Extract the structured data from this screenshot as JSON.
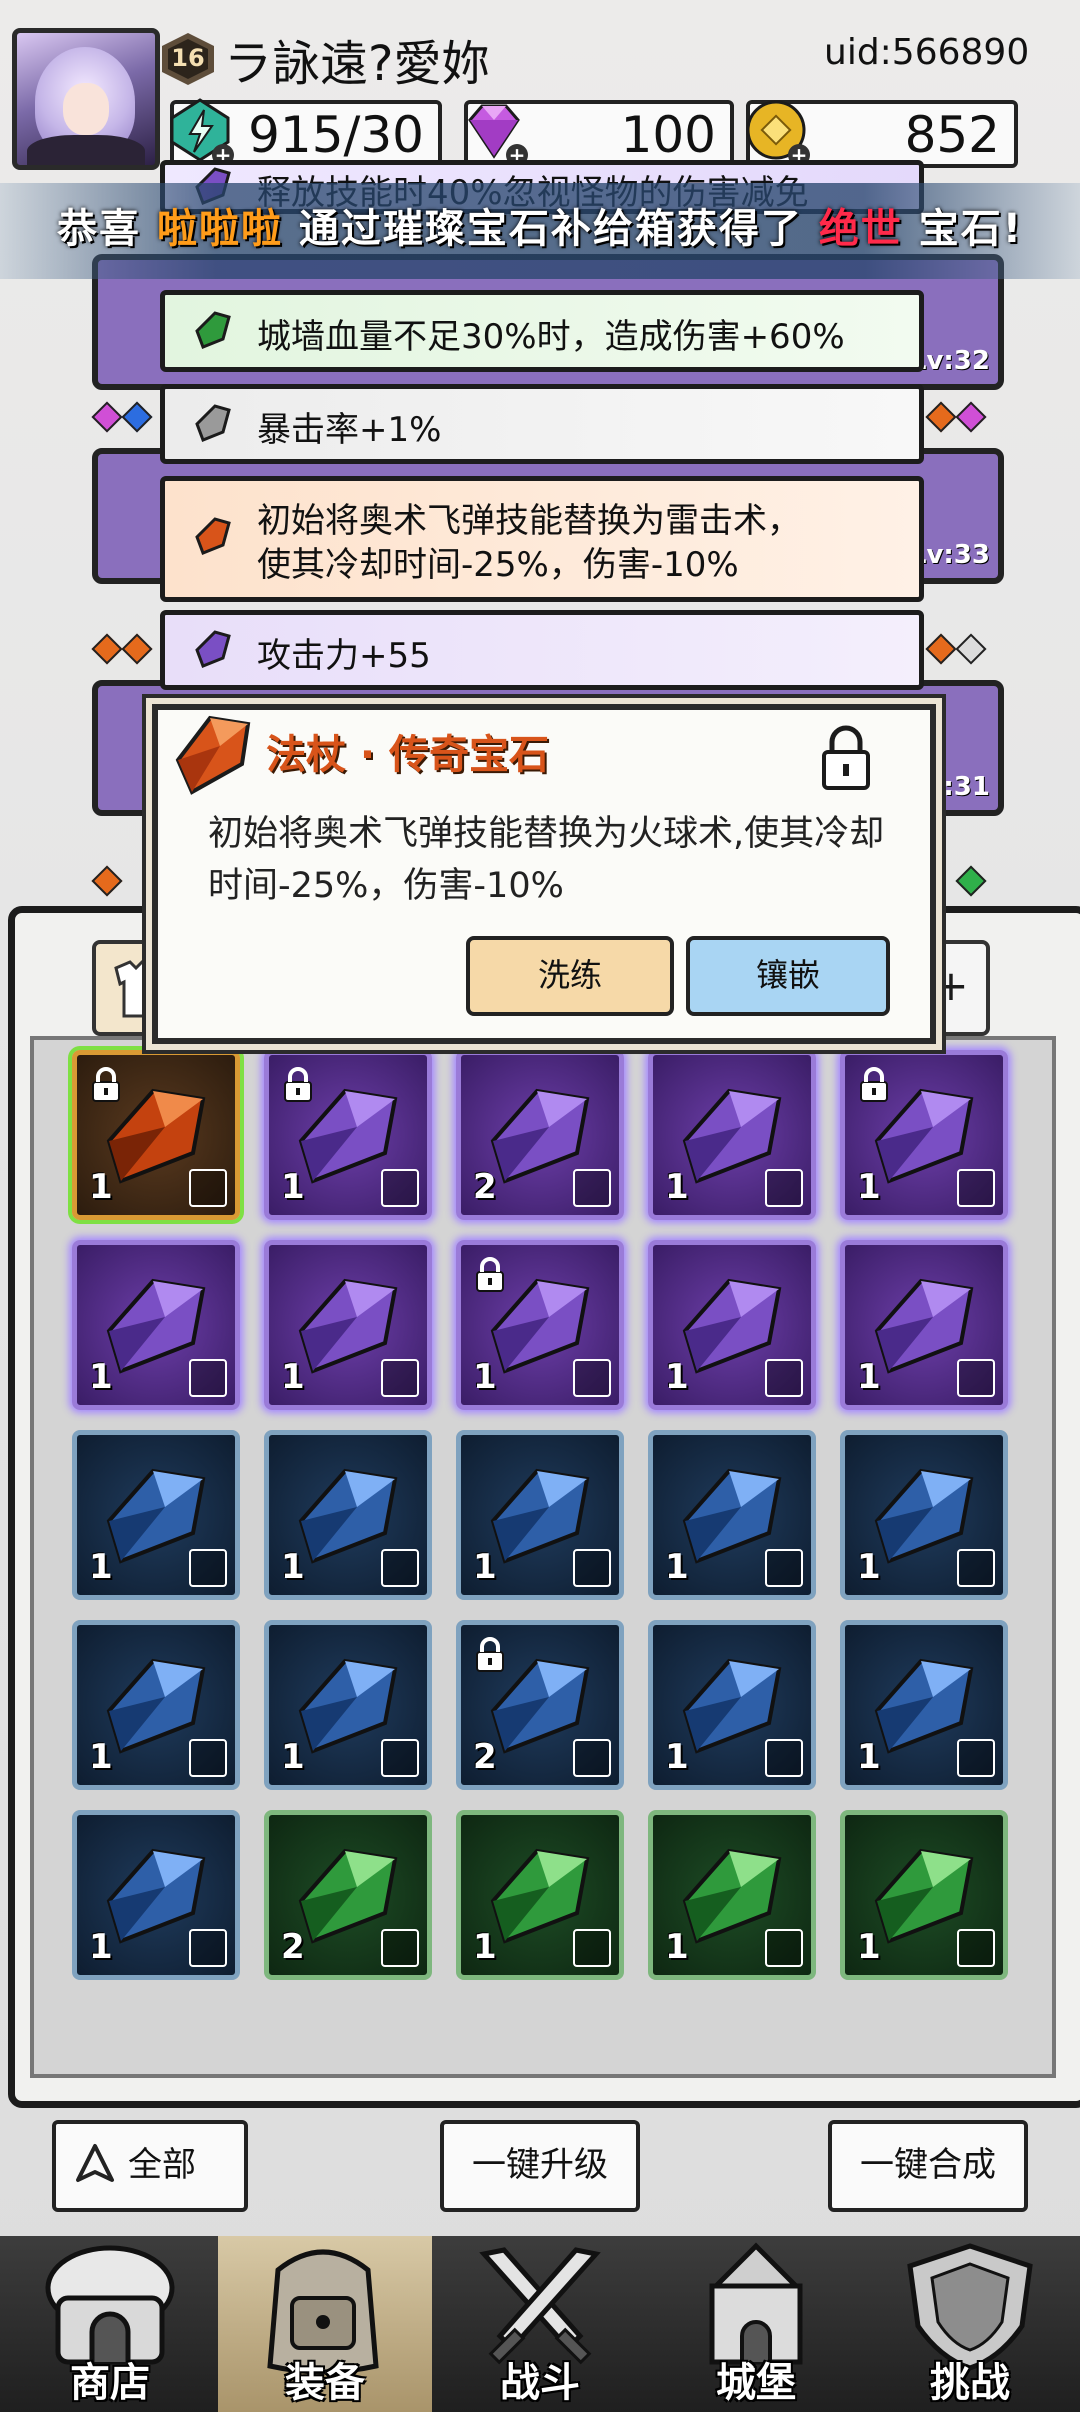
{
  "player": {
    "name": "ラ詠遠?愛妳",
    "level": "16",
    "uid": "uid:566890"
  },
  "resources": {
    "energy": "915/30",
    "gems": "100",
    "gold": "852"
  },
  "banner": {
    "prefix": "恭喜 ",
    "player": "啦啦啦",
    "middle": " 通过璀璨宝石补给箱获得了 ",
    "rarity": "绝世",
    "suffix": " 宝石!"
  },
  "equipment_levels": [
    "Lv:32",
    "Lv:33",
    "Lv:31"
  ],
  "gem_stats": [
    {
      "text": "释放技能时40%忽视怪物的伤害减免",
      "color": "purple"
    },
    {
      "text": "城墙血量不足30%时，造成伤害+60%",
      "color": "green"
    },
    {
      "text": "暴击率+1%",
      "color": "gray"
    },
    {
      "text": "初始将奥术飞弹技能替换为雷击术，",
      "text2": "使其冷却时间-25%，伤害-10%",
      "color": "orange"
    },
    {
      "text": "攻击力+55",
      "color": "purple"
    }
  ],
  "tooltip": {
    "title": "法杖 · 传奇宝石",
    "description": "初始将奥术飞弹技能替换为火球术,使其冷却时间-25%，伤害-10%",
    "refine_label": "洗练",
    "inlay_label": "镶嵌"
  },
  "inventory": [
    {
      "tier": "orange",
      "count": "1",
      "slot": "staff",
      "locked": true
    },
    {
      "tier": "purple",
      "count": "1",
      "slot": "ring",
      "locked": true
    },
    {
      "tier": "purple",
      "count": "2",
      "slot": "ring",
      "locked": false
    },
    {
      "tier": "purple",
      "count": "1",
      "slot": "armor",
      "locked": false
    },
    {
      "tier": "purple",
      "count": "1",
      "slot": "armor",
      "locked": true
    },
    {
      "tier": "purple",
      "count": "1",
      "slot": "boots",
      "locked": false
    },
    {
      "tier": "purple",
      "count": "1",
      "slot": "boots",
      "locked": false
    },
    {
      "tier": "purple",
      "count": "1",
      "slot": "staff",
      "locked": true
    },
    {
      "tier": "purple",
      "count": "1",
      "slot": "necklace",
      "locked": false
    },
    {
      "tier": "purple",
      "count": "1",
      "slot": "necklace",
      "locked": false
    },
    {
      "tier": "blue",
      "count": "1",
      "slot": "ring",
      "locked": false
    },
    {
      "tier": "blue",
      "count": "1",
      "slot": "ring",
      "locked": false
    },
    {
      "tier": "blue",
      "count": "1",
      "slot": "ring",
      "locked": false
    },
    {
      "tier": "blue",
      "count": "1",
      "slot": "armor",
      "locked": false
    },
    {
      "tier": "blue",
      "count": "1",
      "slot": "armor",
      "locked": false
    },
    {
      "tier": "blue",
      "count": "1",
      "slot": "boots",
      "locked": false
    },
    {
      "tier": "blue",
      "count": "1",
      "slot": "boots",
      "locked": false
    },
    {
      "tier": "blue",
      "count": "2",
      "slot": "helmet",
      "locked": true
    },
    {
      "tier": "blue",
      "count": "1",
      "slot": "helmet",
      "locked": false
    },
    {
      "tier": "blue",
      "count": "1",
      "slot": "helmet",
      "locked": false
    },
    {
      "tier": "blue",
      "count": "1",
      "slot": "helmet",
      "locked": false
    },
    {
      "tier": "green",
      "count": "2",
      "slot": "ring",
      "locked": false
    },
    {
      "tier": "green",
      "count": "1",
      "slot": "ring",
      "locked": false
    },
    {
      "tier": "green",
      "count": "1",
      "slot": "ring",
      "locked": false
    },
    {
      "tier": "green",
      "count": "1",
      "slot": "armor",
      "locked": false
    }
  ],
  "actions": {
    "all_label": "全部",
    "upgrade_label": "一键升级",
    "merge_label": "一键合成"
  },
  "nav": [
    {
      "label": "商店",
      "icon": "shop-icon"
    },
    {
      "label": "装备",
      "icon": "backpack-icon",
      "active": true
    },
    {
      "label": "战斗",
      "icon": "crossed-swords-icon"
    },
    {
      "label": "城堡",
      "icon": "castle-icon"
    },
    {
      "label": "挑战",
      "icon": "shield-icon"
    }
  ],
  "colors": {
    "orange": "#d8541a",
    "purple": "#7a4fc4",
    "blue": "#2e5fa8",
    "green": "#2f9a3c",
    "banner_highlight": "#ff9c1a",
    "banner_rarity": "#ff2a4a"
  }
}
